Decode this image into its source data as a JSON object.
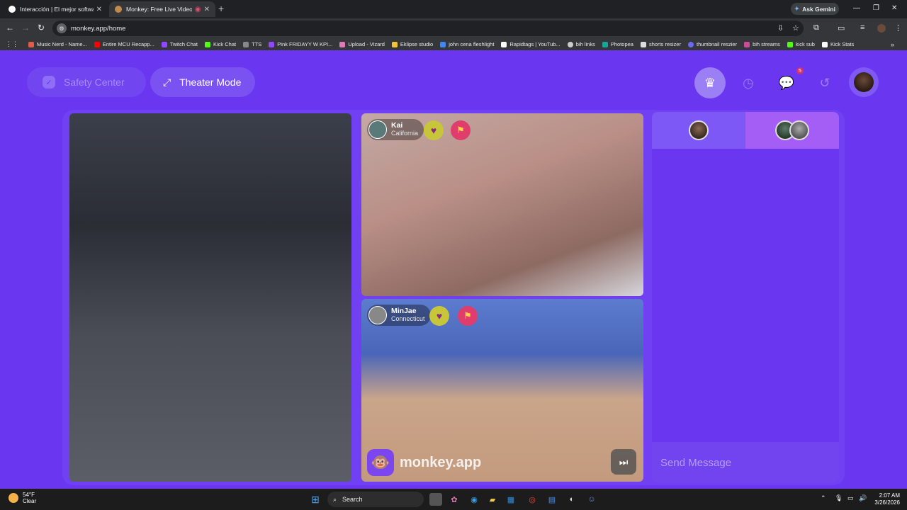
{
  "browser": {
    "tabs": [
      {
        "title": "Interacción | El mejor software"
      },
      {
        "title": "Monkey: Free Live Video Ch"
      }
    ],
    "ask_gemini": "Ask Gemini",
    "url": "monkey.app/home",
    "bookmarks": [
      {
        "label": "Music Nerd - Name...",
        "color": "#e05c4a"
      },
      {
        "label": "Entire MCU Recapp...",
        "color": "#ff0000"
      },
      {
        "label": "Twitch Chat",
        "color": "#9146ff"
      },
      {
        "label": "Kick Chat",
        "color": "#53fc18"
      },
      {
        "label": "TTS",
        "color": "#888888"
      },
      {
        "label": "Pink FRIDAYY W KPI...",
        "color": "#9146ff"
      },
      {
        "label": "Upload - Vizard",
        "color": "#e07ab5"
      },
      {
        "label": "Eklipse studio",
        "color": "#f4c430"
      },
      {
        "label": "john cena fleshlight",
        "color": "#4285f4"
      },
      {
        "label": "Rapidtags | YouTub...",
        "color": "#ffffff"
      },
      {
        "label": "bih links",
        "color": "#cccccc"
      },
      {
        "label": "Photopea",
        "color": "#18a497"
      },
      {
        "label": "shorts resizer",
        "color": "#dddddd"
      },
      {
        "label": "thumbnail reszier",
        "color": "#6a6af4"
      },
      {
        "label": "bih streams",
        "color": "#d04a9a"
      },
      {
        "label": "kick sub",
        "color": "#53fc18"
      },
      {
        "label": "Kick Stats",
        "color": "#ffffff"
      }
    ]
  },
  "app": {
    "safety_center": "Safety Center",
    "theater_mode": "Theater Mode",
    "chat_badge": "5",
    "users": [
      {
        "name": "Kai",
        "location": "California"
      },
      {
        "name": "MinJae",
        "location": "Connecticut"
      }
    ],
    "brand": "monkey.app",
    "send_placeholder": "Send Message",
    "colors": {
      "background": "#6a36f0",
      "accent": "#a45ef5"
    }
  },
  "taskbar": {
    "temp": "54°F",
    "condition": "Clear",
    "search": "Search",
    "time": "2:07 AM",
    "date": "3/26/2026"
  }
}
